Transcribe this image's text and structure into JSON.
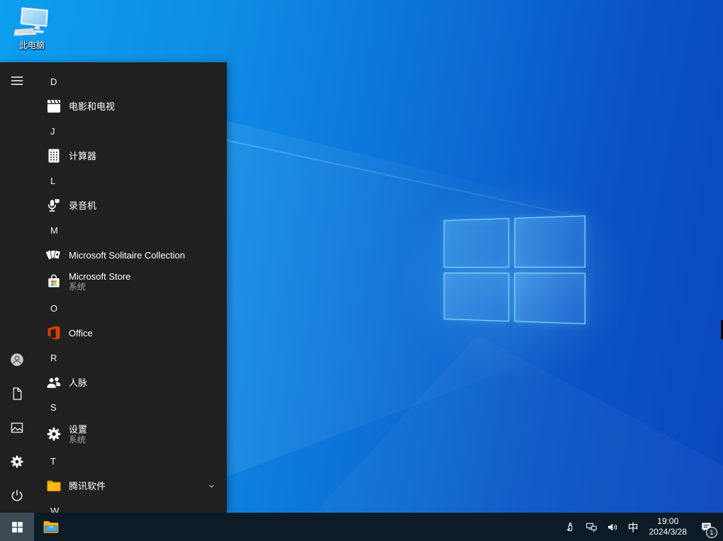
{
  "desktop": {
    "this_pc_label": "此电脑"
  },
  "start_menu": {
    "sections": [
      {
        "letter": "D",
        "items": [
          {
            "label": "电影和电视",
            "icon": "movies-tv"
          }
        ]
      },
      {
        "letter": "J",
        "items": [
          {
            "label": "计算器",
            "icon": "calculator"
          }
        ]
      },
      {
        "letter": "L",
        "items": [
          {
            "label": "录音机",
            "icon": "voice-recorder"
          }
        ]
      },
      {
        "letter": "M",
        "items": [
          {
            "label": "Microsoft Solitaire Collection",
            "icon": "solitaire"
          },
          {
            "label": "Microsoft Store",
            "subtitle": "系统",
            "icon": "microsoft-store"
          }
        ]
      },
      {
        "letter": "O",
        "items": [
          {
            "label": "Office",
            "icon": "office"
          }
        ]
      },
      {
        "letter": "R",
        "items": [
          {
            "label": "人脉",
            "icon": "people"
          }
        ]
      },
      {
        "letter": "S",
        "items": [
          {
            "label": "设置",
            "subtitle": "系统",
            "icon": "settings"
          }
        ]
      },
      {
        "letter": "T",
        "items": [
          {
            "label": "腾讯软件",
            "icon": "folder",
            "chevron": true
          }
        ]
      },
      {
        "letter": "W",
        "items": []
      }
    ],
    "rail": {
      "top": [
        {
          "name": "menu",
          "icon": "hamburger"
        }
      ],
      "bottom": [
        {
          "name": "account",
          "icon": "account"
        },
        {
          "name": "documents",
          "icon": "document"
        },
        {
          "name": "pictures",
          "icon": "picture"
        },
        {
          "name": "settings",
          "icon": "settings"
        },
        {
          "name": "power",
          "icon": "power"
        }
      ]
    }
  },
  "taskbar": {
    "tray": {
      "ime": "中",
      "time": "19:00",
      "date": "2024/3/28",
      "notification_count": "1"
    }
  },
  "colors": {
    "menu_bg": "#202020",
    "taskbar_bg": "#0c1b26",
    "start_button_active": "#3c4a55",
    "wallpaper_left": "#0d9ff0",
    "wallpaper_right": "#0a47bd",
    "logo_border": "#96ebff"
  }
}
